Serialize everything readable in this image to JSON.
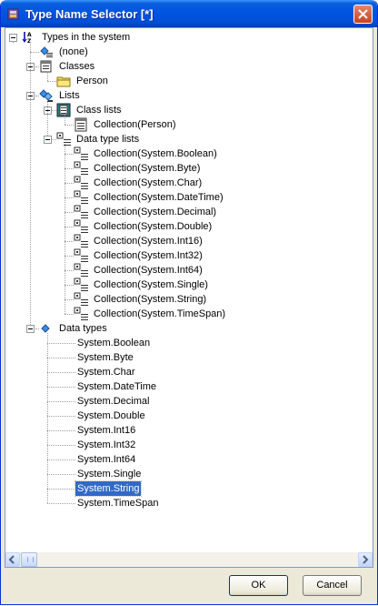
{
  "window": {
    "title": "Type Name Selector [*]"
  },
  "tree": {
    "root": "Types in the system",
    "none": "(none)",
    "classes": {
      "label": "Classes",
      "items": [
        "Person"
      ]
    },
    "lists": {
      "label": "Lists",
      "class_lists": {
        "label": "Class lists",
        "items": [
          "Collection(Person)"
        ]
      },
      "data_type_lists": {
        "label": "Data type lists",
        "items": [
          "Collection(System.Boolean)",
          "Collection(System.Byte)",
          "Collection(System.Char)",
          "Collection(System.DateTime)",
          "Collection(System.Decimal)",
          "Collection(System.Double)",
          "Collection(System.Int16)",
          "Collection(System.Int32)",
          "Collection(System.Int64)",
          "Collection(System.Single)",
          "Collection(System.String)",
          "Collection(System.TimeSpan)"
        ]
      }
    },
    "data_types": {
      "label": "Data types",
      "items": [
        "System.Boolean",
        "System.Byte",
        "System.Char",
        "System.DateTime",
        "System.Decimal",
        "System.Double",
        "System.Int16",
        "System.Int32",
        "System.Int64",
        "System.Single",
        "System.String",
        "System.TimeSpan"
      ],
      "selected": "System.String"
    }
  },
  "buttons": {
    "ok": "OK",
    "cancel": "Cancel"
  }
}
